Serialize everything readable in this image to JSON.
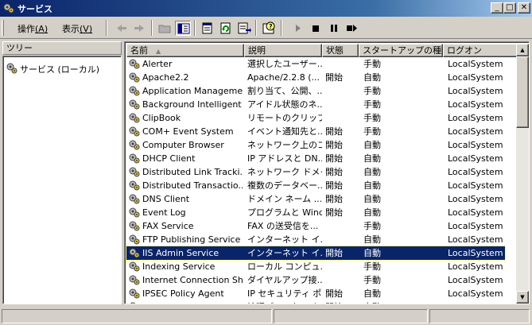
{
  "window": {
    "title": "サービス"
  },
  "menu": {
    "action": {
      "label": "操作",
      "accel": "(A)"
    },
    "view": {
      "label": "表示",
      "accel": "(V)"
    }
  },
  "toolbar": {
    "buttons": [
      "back-icon",
      "forward-icon",
      "up-folder-icon",
      "show-hide-tree-icon",
      "properties-icon",
      "refresh-icon",
      "export-list-icon",
      "help-icon",
      "play-icon",
      "stop-icon",
      "pause-icon",
      "restart-icon"
    ]
  },
  "tree": {
    "header": "ツリー",
    "root": "サービス (ローカル)"
  },
  "list": {
    "columns": {
      "name": "名前",
      "description": "説明",
      "status": "状態",
      "startup": "スタートアップの種類",
      "logon": "ログオン"
    },
    "rows": [
      {
        "name": "Alerter",
        "description": "選択したユーザー...",
        "status": "",
        "startup": "手動",
        "logon": "LocalSystem"
      },
      {
        "name": "Apache2.2",
        "description": "Apache/2.2.8 (...",
        "status": "開始",
        "startup": "自動",
        "logon": "LocalSystem"
      },
      {
        "name": "Application Manageme...",
        "description": "割り当て、公開、...",
        "status": "",
        "startup": "手動",
        "logon": "LocalSystem"
      },
      {
        "name": "Background Intelligent ...",
        "description": "アイドル状態のネ...",
        "status": "",
        "startup": "手動",
        "logon": "LocalSystem"
      },
      {
        "name": "ClipBook",
        "description": "リモートのクリップ...",
        "status": "",
        "startup": "手動",
        "logon": "LocalSystem"
      },
      {
        "name": "COM+ Event System",
        "description": "イベント通知先と...",
        "status": "開始",
        "startup": "手動",
        "logon": "LocalSystem"
      },
      {
        "name": "Computer Browser",
        "description": "ネットワーク上のコ...",
        "status": "開始",
        "startup": "自動",
        "logon": "LocalSystem"
      },
      {
        "name": "DHCP Client",
        "description": "IP アドレスと DN...",
        "status": "開始",
        "startup": "自動",
        "logon": "LocalSystem"
      },
      {
        "name": "Distributed Link Tracki...",
        "description": "ネットワーク ドメイ...",
        "status": "開始",
        "startup": "自動",
        "logon": "LocalSystem"
      },
      {
        "name": "Distributed Transactio...",
        "description": "複数のデータベー...",
        "status": "開始",
        "startup": "自動",
        "logon": "LocalSystem"
      },
      {
        "name": "DNS Client",
        "description": "ドメイン ネーム ...",
        "status": "開始",
        "startup": "自動",
        "logon": "LocalSystem"
      },
      {
        "name": "Event Log",
        "description": "プログラムと Wind...",
        "status": "開始",
        "startup": "自動",
        "logon": "LocalSystem"
      },
      {
        "name": "FAX Service",
        "description": "FAX の送受信を...",
        "status": "",
        "startup": "手動",
        "logon": "LocalSystem"
      },
      {
        "name": "FTP Publishing Service",
        "description": "インターネット イ...",
        "status": "",
        "startup": "自動",
        "logon": "LocalSystem"
      },
      {
        "name": "IIS Admin Service",
        "description": "インターネット イ...",
        "status": "開始",
        "startup": "自動",
        "logon": "LocalSystem",
        "selected": true
      },
      {
        "name": "Indexing Service",
        "description": "ローカル コンピュ...",
        "status": "",
        "startup": "手動",
        "logon": "LocalSystem"
      },
      {
        "name": "Internet Connection Sh...",
        "description": "ダイヤルアップ接...",
        "status": "",
        "startup": "手動",
        "logon": "LocalSystem"
      },
      {
        "name": "IPSEC Policy Agent",
        "description": "IP セキュリティ ポ...",
        "status": "開始",
        "startup": "自動",
        "logon": "LocalSystem"
      },
      {
        "name": "Logical Disk Manager",
        "description": "論理ディスク マネ...",
        "status": "開始",
        "startup": "自動",
        "logon": "LocalSystem"
      }
    ]
  }
}
